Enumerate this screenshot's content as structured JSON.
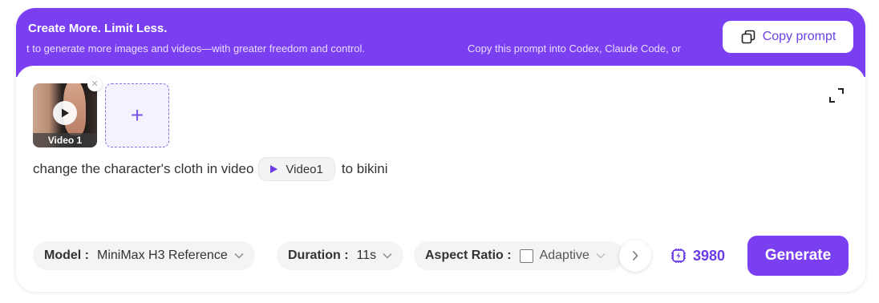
{
  "banner": {
    "title": "Create More. Limit Less.",
    "subtitle": "t to generate more images and videos—with greater freedom and control.",
    "ticker_text": "Copy this prompt into Codex, Claude Code, or",
    "copy_button_label": "Copy prompt",
    "color": "#7b3ff2"
  },
  "media": {
    "thumbnail_label": "Video 1",
    "thumbnail_icon": "play-icon",
    "remove_icon": "close-icon",
    "add_icon": "plus-icon"
  },
  "prompt": {
    "text_before": "change the character's cloth in video",
    "chip_label": "Video1",
    "text_after": "to bikini"
  },
  "controls": {
    "model_label": "Model :",
    "model_value": "MiniMax H3 Reference",
    "duration_label": "Duration :",
    "duration_value": "11s",
    "aspect_label": "Aspect Ratio :",
    "aspect_value": "Adaptive",
    "credits": "3980",
    "generate_label": "Generate",
    "accent_color": "#6a3be6"
  }
}
